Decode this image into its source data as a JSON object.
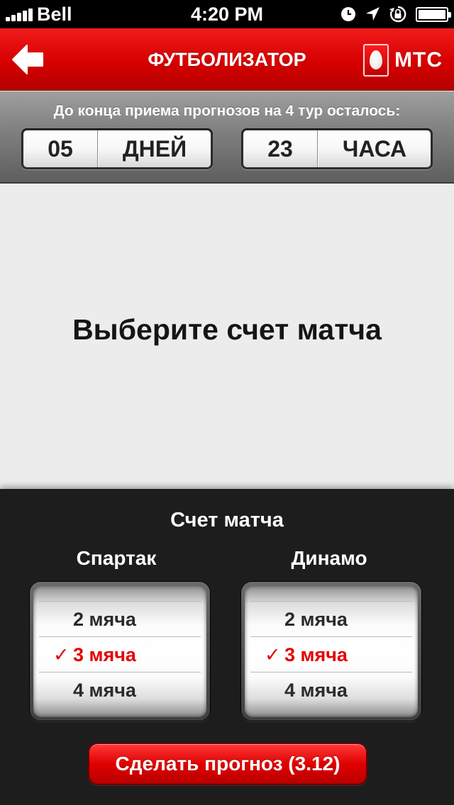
{
  "status_bar": {
    "carrier": "Bell",
    "time": "4:20 PM",
    "signal_bars": 5,
    "battery_level": 1.0,
    "icons": [
      "clock-icon",
      "location-arrow-icon",
      "rotation-lock-icon",
      "battery-icon"
    ]
  },
  "header": {
    "title": "ФУТБОЛИЗАТОР",
    "back_icon": "back-arrow-icon",
    "logo_text": "МТС",
    "accent_color": "#e00000"
  },
  "countdown": {
    "label": "До конца приема прогнозов на 4 тур осталось:",
    "days_value": "05",
    "days_unit": "ДНЕЙ",
    "hours_value": "23",
    "hours_unit": "ЧАСА"
  },
  "main": {
    "prompt": "Выберите счет матча"
  },
  "score_panel": {
    "title": "Счет матча",
    "home_team": {
      "name": "Спартак",
      "options": [
        "2 мяча",
        "3 мяча",
        "4 мяча"
      ],
      "selected": "3 мяча"
    },
    "away_team": {
      "name": "Динамо",
      "options": [
        "2 мяча",
        "3 мяча",
        "4 мяча"
      ],
      "selected": "3 мяча"
    },
    "check_glyph": "✓",
    "submit_label": "Сделать прогноз (3.12)"
  }
}
